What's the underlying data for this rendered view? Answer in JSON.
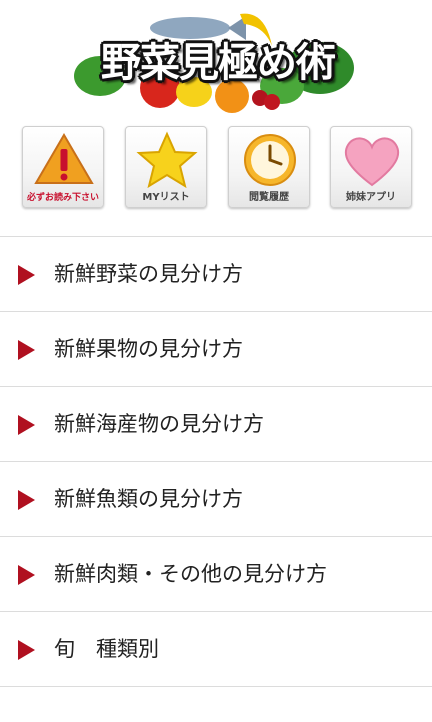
{
  "header": {
    "title": "野菜見極め術"
  },
  "quick_links": [
    {
      "label": "必ずお読み下さい",
      "icon": "warning-icon"
    },
    {
      "label": "MYリスト",
      "icon": "star-icon"
    },
    {
      "label": "閲覧履歴",
      "icon": "clock-icon"
    },
    {
      "label": "姉妹アプリ",
      "icon": "heart-icon"
    }
  ],
  "menu": [
    {
      "label": "新鮮野菜の見分け方"
    },
    {
      "label": "新鮮果物の見分け方"
    },
    {
      "label": "新鮮海産物の見分け方"
    },
    {
      "label": "新鮮魚類の見分け方"
    },
    {
      "label": "新鮮肉類・その他の見分け方"
    },
    {
      "label": "旬　種類別"
    }
  ],
  "colors": {
    "accent_red": "#c8102e",
    "divider": "#dcdcdc"
  }
}
